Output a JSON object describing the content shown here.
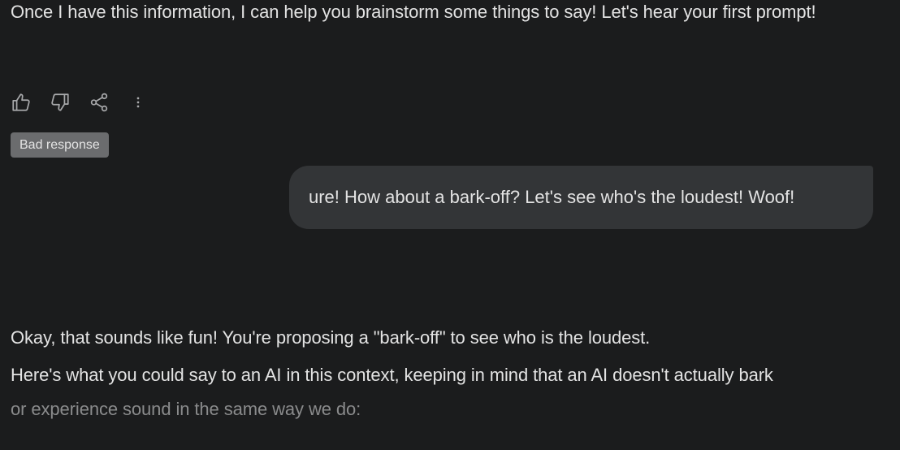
{
  "conversation": {
    "model_response_1": {
      "text": "Once I have this information, I can help you brainstorm some things to say! Let's hear your first prompt!",
      "actions": {
        "thumbs_up_icon": "thumbs-up-icon",
        "thumbs_down_icon": "thumbs-down-icon",
        "share_icon": "share-icon",
        "more_icon": "more-vert-icon"
      },
      "feedback_badge": "Bad response"
    },
    "user_message": {
      "text": "ure! How about a bark-off? Let's see who's the loudest! Woof!"
    },
    "model_response_2": {
      "paragraph_1": "Okay, that sounds like fun! You're proposing a \"bark-off\" to see who is the loudest.",
      "paragraph_2_line_1": "Here's what you could say to an AI in this context, keeping in mind that an AI doesn't actually bark",
      "paragraph_2_line_2": "or experience sound in the same way we do:"
    }
  },
  "colors": {
    "background": "#1b1c1d",
    "text": "#e3e3e3",
    "user_bubble": "#333537",
    "badge_bg": "#6b6c6e",
    "icon": "#a8a9ab",
    "faded_text": "#8a8b8c"
  }
}
